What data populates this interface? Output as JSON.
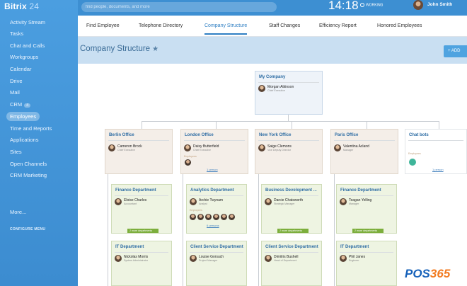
{
  "sidebar": {
    "logo": {
      "name": "Bitrix",
      "num": "24"
    },
    "items": [
      {
        "label": "Activity Stream"
      },
      {
        "label": "Tasks"
      },
      {
        "label": "Chat and Calls"
      },
      {
        "label": "Workgroups"
      },
      {
        "label": "Calendar"
      },
      {
        "label": "Drive"
      },
      {
        "label": "Mail"
      },
      {
        "label": "CRM",
        "badge": "4"
      },
      {
        "label": "Employees"
      },
      {
        "label": "Time and Reports"
      },
      {
        "label": "Applications"
      },
      {
        "label": "Sites"
      },
      {
        "label": "Open Channels"
      },
      {
        "label": "CRM Marketing"
      }
    ],
    "more": "More...",
    "configure": "CONFIGURE MENU"
  },
  "topbar": {
    "search_placeholder": "find people, documents, and more",
    "clock": "14:18",
    "status": "WORKING",
    "user": "John Smith"
  },
  "tabs": [
    {
      "label": "Find Employee"
    },
    {
      "label": "Telephone Directory"
    },
    {
      "label": "Company Structure"
    },
    {
      "label": "Staff Changes"
    },
    {
      "label": "Efficiency Report"
    },
    {
      "label": "Honored Employees"
    }
  ],
  "page": {
    "title": "Company Structure",
    "add": "ADD"
  },
  "root": {
    "title": "My Company",
    "person": "Morgan Atkinson",
    "role": "Chief Executive"
  },
  "offices": [
    {
      "title": "Berlin Office",
      "person": "Cameron Brock",
      "role": "Chief Executive"
    },
    {
      "title": "London Office",
      "person": "Daisy Butterfield",
      "role": "Chief Executive",
      "emp_label": "Employees",
      "link": "1 person"
    },
    {
      "title": "New York Office",
      "person": "Saige Clemons",
      "role": "Vice Deputy Director"
    },
    {
      "title": "Paris Office",
      "person": "Valentina Acland",
      "role": "Manager"
    },
    {
      "title": "Chat bots",
      "emp_label": "Employees",
      "link": "1 person"
    }
  ],
  "depts": [
    {
      "title": "Finance Department",
      "person": "Eloise Charles",
      "role": "Accountant",
      "more": "2 more departments"
    },
    {
      "title": "Analytics Department",
      "person": "Archie Twynam",
      "role": "Analyst",
      "emp_label": "Employees",
      "link": "6 persons"
    },
    {
      "title": "Business Development ...",
      "person": "Darcie Chatsworth",
      "role": "Strategic Manager",
      "more": "2 more departments"
    },
    {
      "title": "Finance Department",
      "person": "Teagan Yelling",
      "role": "Manager",
      "more": "2 more departments"
    }
  ],
  "depts2": [
    {
      "title": "IT Department",
      "person": "Nickolas Morris",
      "role": "System Administrator"
    },
    {
      "title": "Client Service Department",
      "person": "Louise Gorsuch",
      "role": "Project Manager"
    },
    {
      "title": "Client Service Department",
      "person": "Dimitris Bushell",
      "role": "Head of Department"
    },
    {
      "title": "IT Department",
      "person": "Phil Janes",
      "role": "Engineer"
    }
  ],
  "brand": {
    "pos": "POS",
    "num": "365"
  }
}
